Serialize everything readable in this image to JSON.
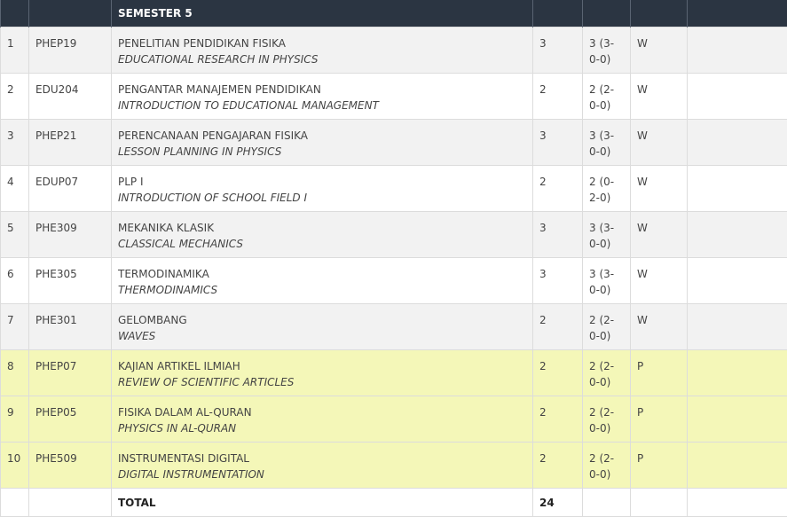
{
  "header": {
    "semester_label": "SEMESTER 5"
  },
  "courses": [
    {
      "no": "1",
      "code": "PHEP19",
      "name_id": "PENELITIAN PENDIDIKAN FISIKA",
      "name_en": "EDUCATIONAL RESEARCH IN PHYSICS",
      "sks": "3",
      "detail": "3 (3-0-0)",
      "type": "W",
      "shade": "grey"
    },
    {
      "no": "2",
      "code": "EDU204",
      "name_id": "PENGANTAR MANAJEMEN PENDIDIKAN",
      "name_en": "INTRODUCTION TO EDUCATIONAL MANAGEMENT",
      "sks": "2",
      "detail": "2 (2-0-0)",
      "type": "W",
      "shade": "white"
    },
    {
      "no": "3",
      "code": "PHEP21",
      "name_id": "PERENCANAAN PENGAJARAN FISIKA",
      "name_en": "LESSON PLANNING IN PHYSICS",
      "sks": "3",
      "detail": "3 (3-0-0)",
      "type": "W",
      "shade": "grey"
    },
    {
      "no": "4",
      "code": "EDUP07",
      "name_id": "PLP I",
      "name_en": "INTRODUCTION OF SCHOOL FIELD I",
      "sks": "2",
      "detail": "2 (0-2-0)",
      "type": "W",
      "shade": "white"
    },
    {
      "no": "5",
      "code": "PHE309",
      "name_id": "MEKANIKA KLASIK",
      "name_en": "CLASSICAL MECHANICS",
      "sks": "3",
      "detail": "3 (3-0-0)",
      "type": "W",
      "shade": "grey"
    },
    {
      "no": "6",
      "code": "PHE305",
      "name_id": "TERMODINAMIKA",
      "name_en": "THERMODINAMICS",
      "sks": "3",
      "detail": "3 (3-0-0)",
      "type": "W",
      "shade": "white"
    },
    {
      "no": "7",
      "code": "PHE301",
      "name_id": "GELOMBANG",
      "name_en": "WAVES",
      "sks": "2",
      "detail": "2 (2-0-0)",
      "type": "W",
      "shade": "grey"
    },
    {
      "no": "8",
      "code": "PHEP07",
      "name_id": "KAJIAN ARTIKEL ILMIAH",
      "name_en": "REVIEW OF SCIENTIFIC ARTICLES",
      "sks": "2",
      "detail": "2 (2-0-0)",
      "type": "P",
      "shade": "yellow"
    },
    {
      "no": "9",
      "code": "PHEP05",
      "name_id": "FISIKA DALAM AL-QURAN",
      "name_en": "PHYSICS IN AL-QURAN",
      "sks": "2",
      "detail": "2 (2-0-0)",
      "type": "P",
      "shade": "yellow"
    },
    {
      "no": "10",
      "code": "PHE509",
      "name_id": "INSTRUMENTASI DIGITAL",
      "name_en": "DIGITAL INSTRUMENTATION",
      "sks": "2",
      "detail": "2 (2-0-0)",
      "type": "P",
      "shade": "yellow"
    }
  ],
  "total": {
    "label": "TOTAL",
    "value": "24"
  }
}
